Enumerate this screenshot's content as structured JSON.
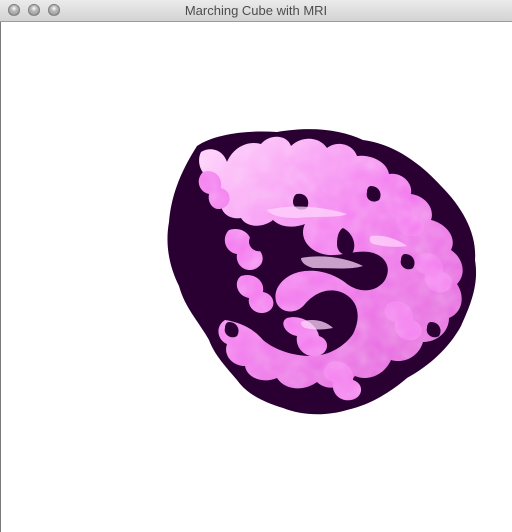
{
  "window": {
    "title": "Marching Cube with MRI"
  },
  "render": {
    "background_color": "#ffffff",
    "gray_matter_color": "#2a0033",
    "white_matter_color": "#f47bf0",
    "white_matter_highlight_color": "#ffd6fb"
  }
}
